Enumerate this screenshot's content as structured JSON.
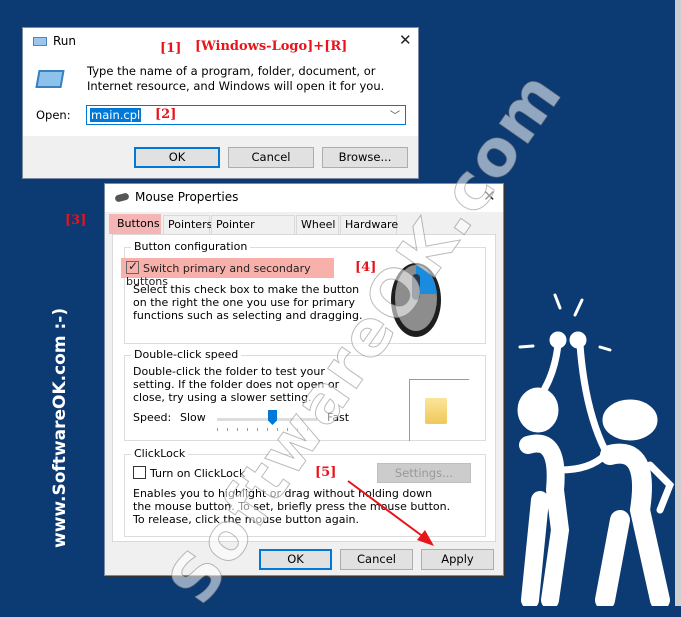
{
  "background_color": "#0c3a73",
  "side_text": "www.SoftwareOK.com :-)",
  "watermark": "SoftwareOK.com",
  "annotations": {
    "a1": "[1]",
    "hotkey": "[Windows-Logo]+[R]",
    "a2": "[2]",
    "a3": "[3]",
    "a4": "[4]",
    "a5": "[5]"
  },
  "run": {
    "title": "Run",
    "description": "Type the name of a program, folder, document, or Internet resource, and Windows will open it for you.",
    "open_label": "Open:",
    "open_value": "main.cpl",
    "ok": "OK",
    "cancel": "Cancel",
    "browse": "Browse..."
  },
  "mouse": {
    "title": "Mouse Properties",
    "tabs": [
      {
        "label": "Buttons",
        "active": true
      },
      {
        "label": "Pointers"
      },
      {
        "label": "Pointer Options"
      },
      {
        "label": "Wheel"
      },
      {
        "label": "Hardware"
      }
    ],
    "button_config": {
      "title": "Button configuration",
      "checkbox": "Switch primary and secondary buttons",
      "checked": true,
      "description": "Select this check box to make the button on the right the one you use for primary functions such as selecting and dragging."
    },
    "double_click": {
      "title": "Double-click speed",
      "description": "Double-click the folder to test your setting. If the folder does not open or close, try using a slower setting.",
      "speed_label": "Speed:",
      "slow": "Slow",
      "fast": "Fast",
      "speed_value_percent": 55
    },
    "clicklock": {
      "title": "ClickLock",
      "checkbox": "Turn on ClickLock",
      "checked": false,
      "settings": "Settings...",
      "description": "Enables you to highlight or drag without holding down the mouse button. To set, briefly press the mouse button. To release, click the mouse button again."
    },
    "ok": "OK",
    "cancel": "Cancel",
    "apply": "Apply"
  }
}
